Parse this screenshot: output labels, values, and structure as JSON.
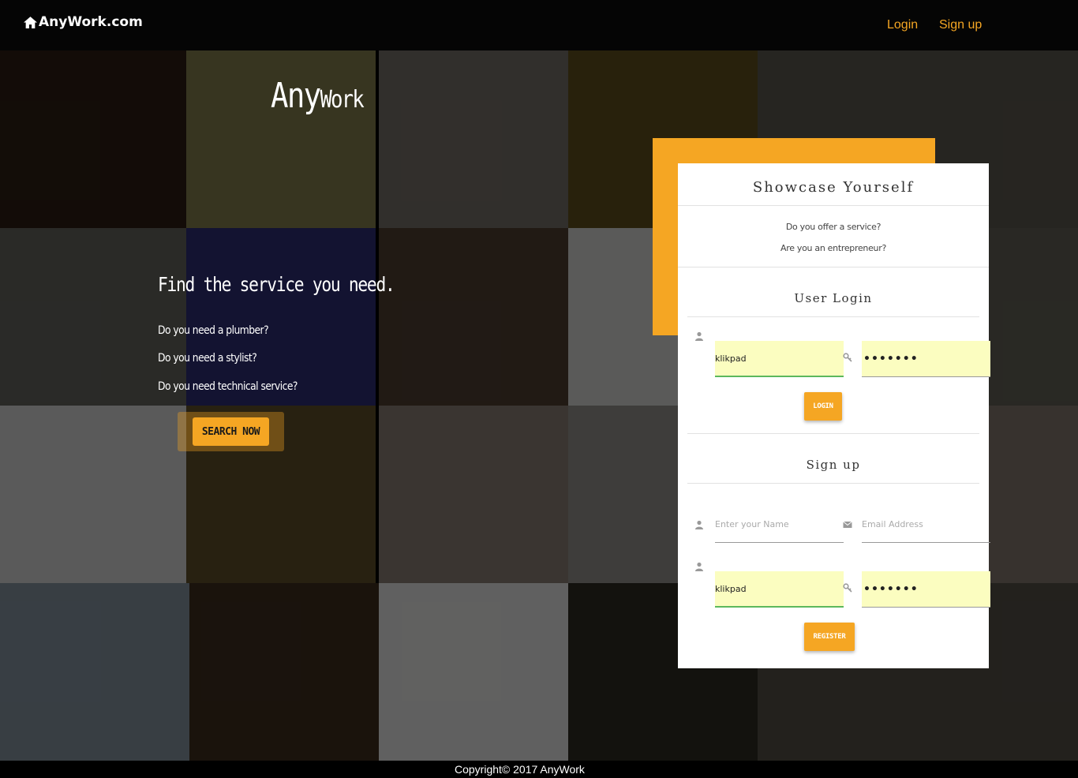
{
  "navbar": {
    "brand": "AnyWork.com",
    "login": "Login",
    "signup": "Sign up"
  },
  "hero": {
    "title_big": "Any",
    "title_small": "Work",
    "heading": "Find the service you need.",
    "questions": [
      "Do you need a plumber?",
      "Do you need a stylist?",
      "Do you need technical service?"
    ],
    "search_button": "SEARCH NOW"
  },
  "panel": {
    "title": "Showcase Yourself",
    "sub1": "Do you offer a service?",
    "sub2": "Are you an entrepreneur?",
    "login": {
      "title": "User Login",
      "username_value": "klikpad",
      "password_value": "•••••••",
      "button": "LOGIN"
    },
    "signup": {
      "title": "Sign up",
      "name_placeholder": "Enter your Name",
      "email_placeholder": "Email Address",
      "username_value": "klikpad",
      "password_value": "•••••••",
      "button": "REGISTER"
    }
  },
  "footer": {
    "text": "Copyright© 2017 AnyWork"
  },
  "colors": {
    "accent": "#f5a623",
    "navbar": "#050505",
    "autofill": "#fbfdc0"
  }
}
